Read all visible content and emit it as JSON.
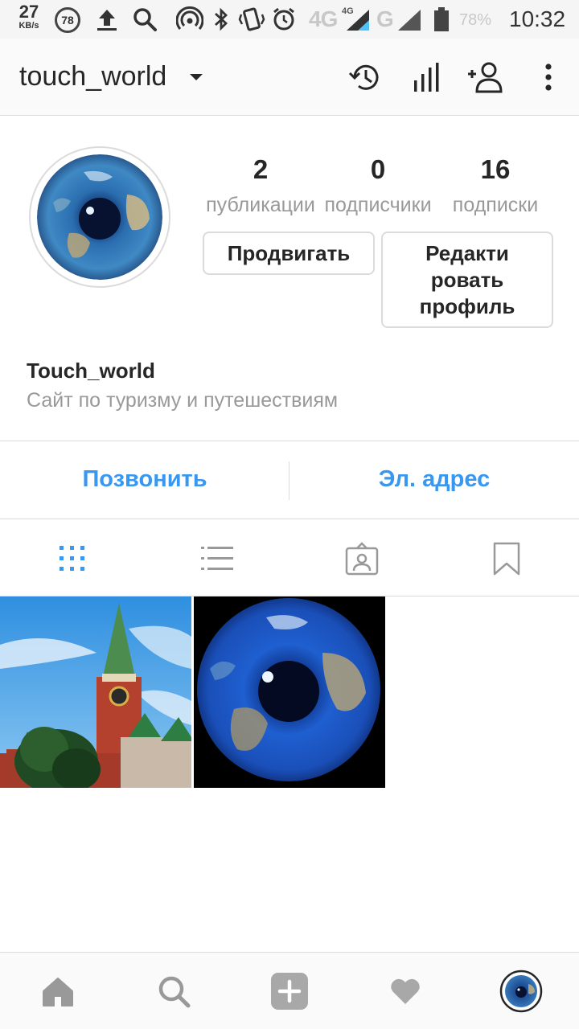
{
  "status_bar": {
    "speed": "27",
    "speed_unit": "KB/s",
    "badge": "78",
    "network_label": "4G",
    "network_small": "4G",
    "network_label2": "G",
    "battery_pct": "78%",
    "time": "10:32"
  },
  "header": {
    "username": "touch_world",
    "icons": [
      "history-icon",
      "insights-icon",
      "add-person-icon",
      "more-icon"
    ]
  },
  "profile": {
    "stats": [
      {
        "value": "2",
        "label": "публикации"
      },
      {
        "value": "0",
        "label": "подписчики"
      },
      {
        "value": "16",
        "label": "подписки"
      }
    ],
    "promote_label": "Продвигать",
    "edit_line1": "Редакти",
    "edit_line2": "ровать",
    "edit_line3": "профиль",
    "name": "Touch_world",
    "bio": "Сайт по туризму и путешествиям"
  },
  "contacts": {
    "call": "Позвонить",
    "email": "Эл. адрес"
  },
  "tabs": [
    "grid-icon",
    "list-icon",
    "tagged-icon",
    "saved-icon"
  ],
  "colors": {
    "accent": "#3897f0",
    "text": "#262626",
    "muted": "#999999",
    "border": "#dbdbdb"
  },
  "bottom_nav": [
    "home-icon",
    "search-icon",
    "add-post-icon",
    "activity-icon",
    "profile-avatar"
  ]
}
